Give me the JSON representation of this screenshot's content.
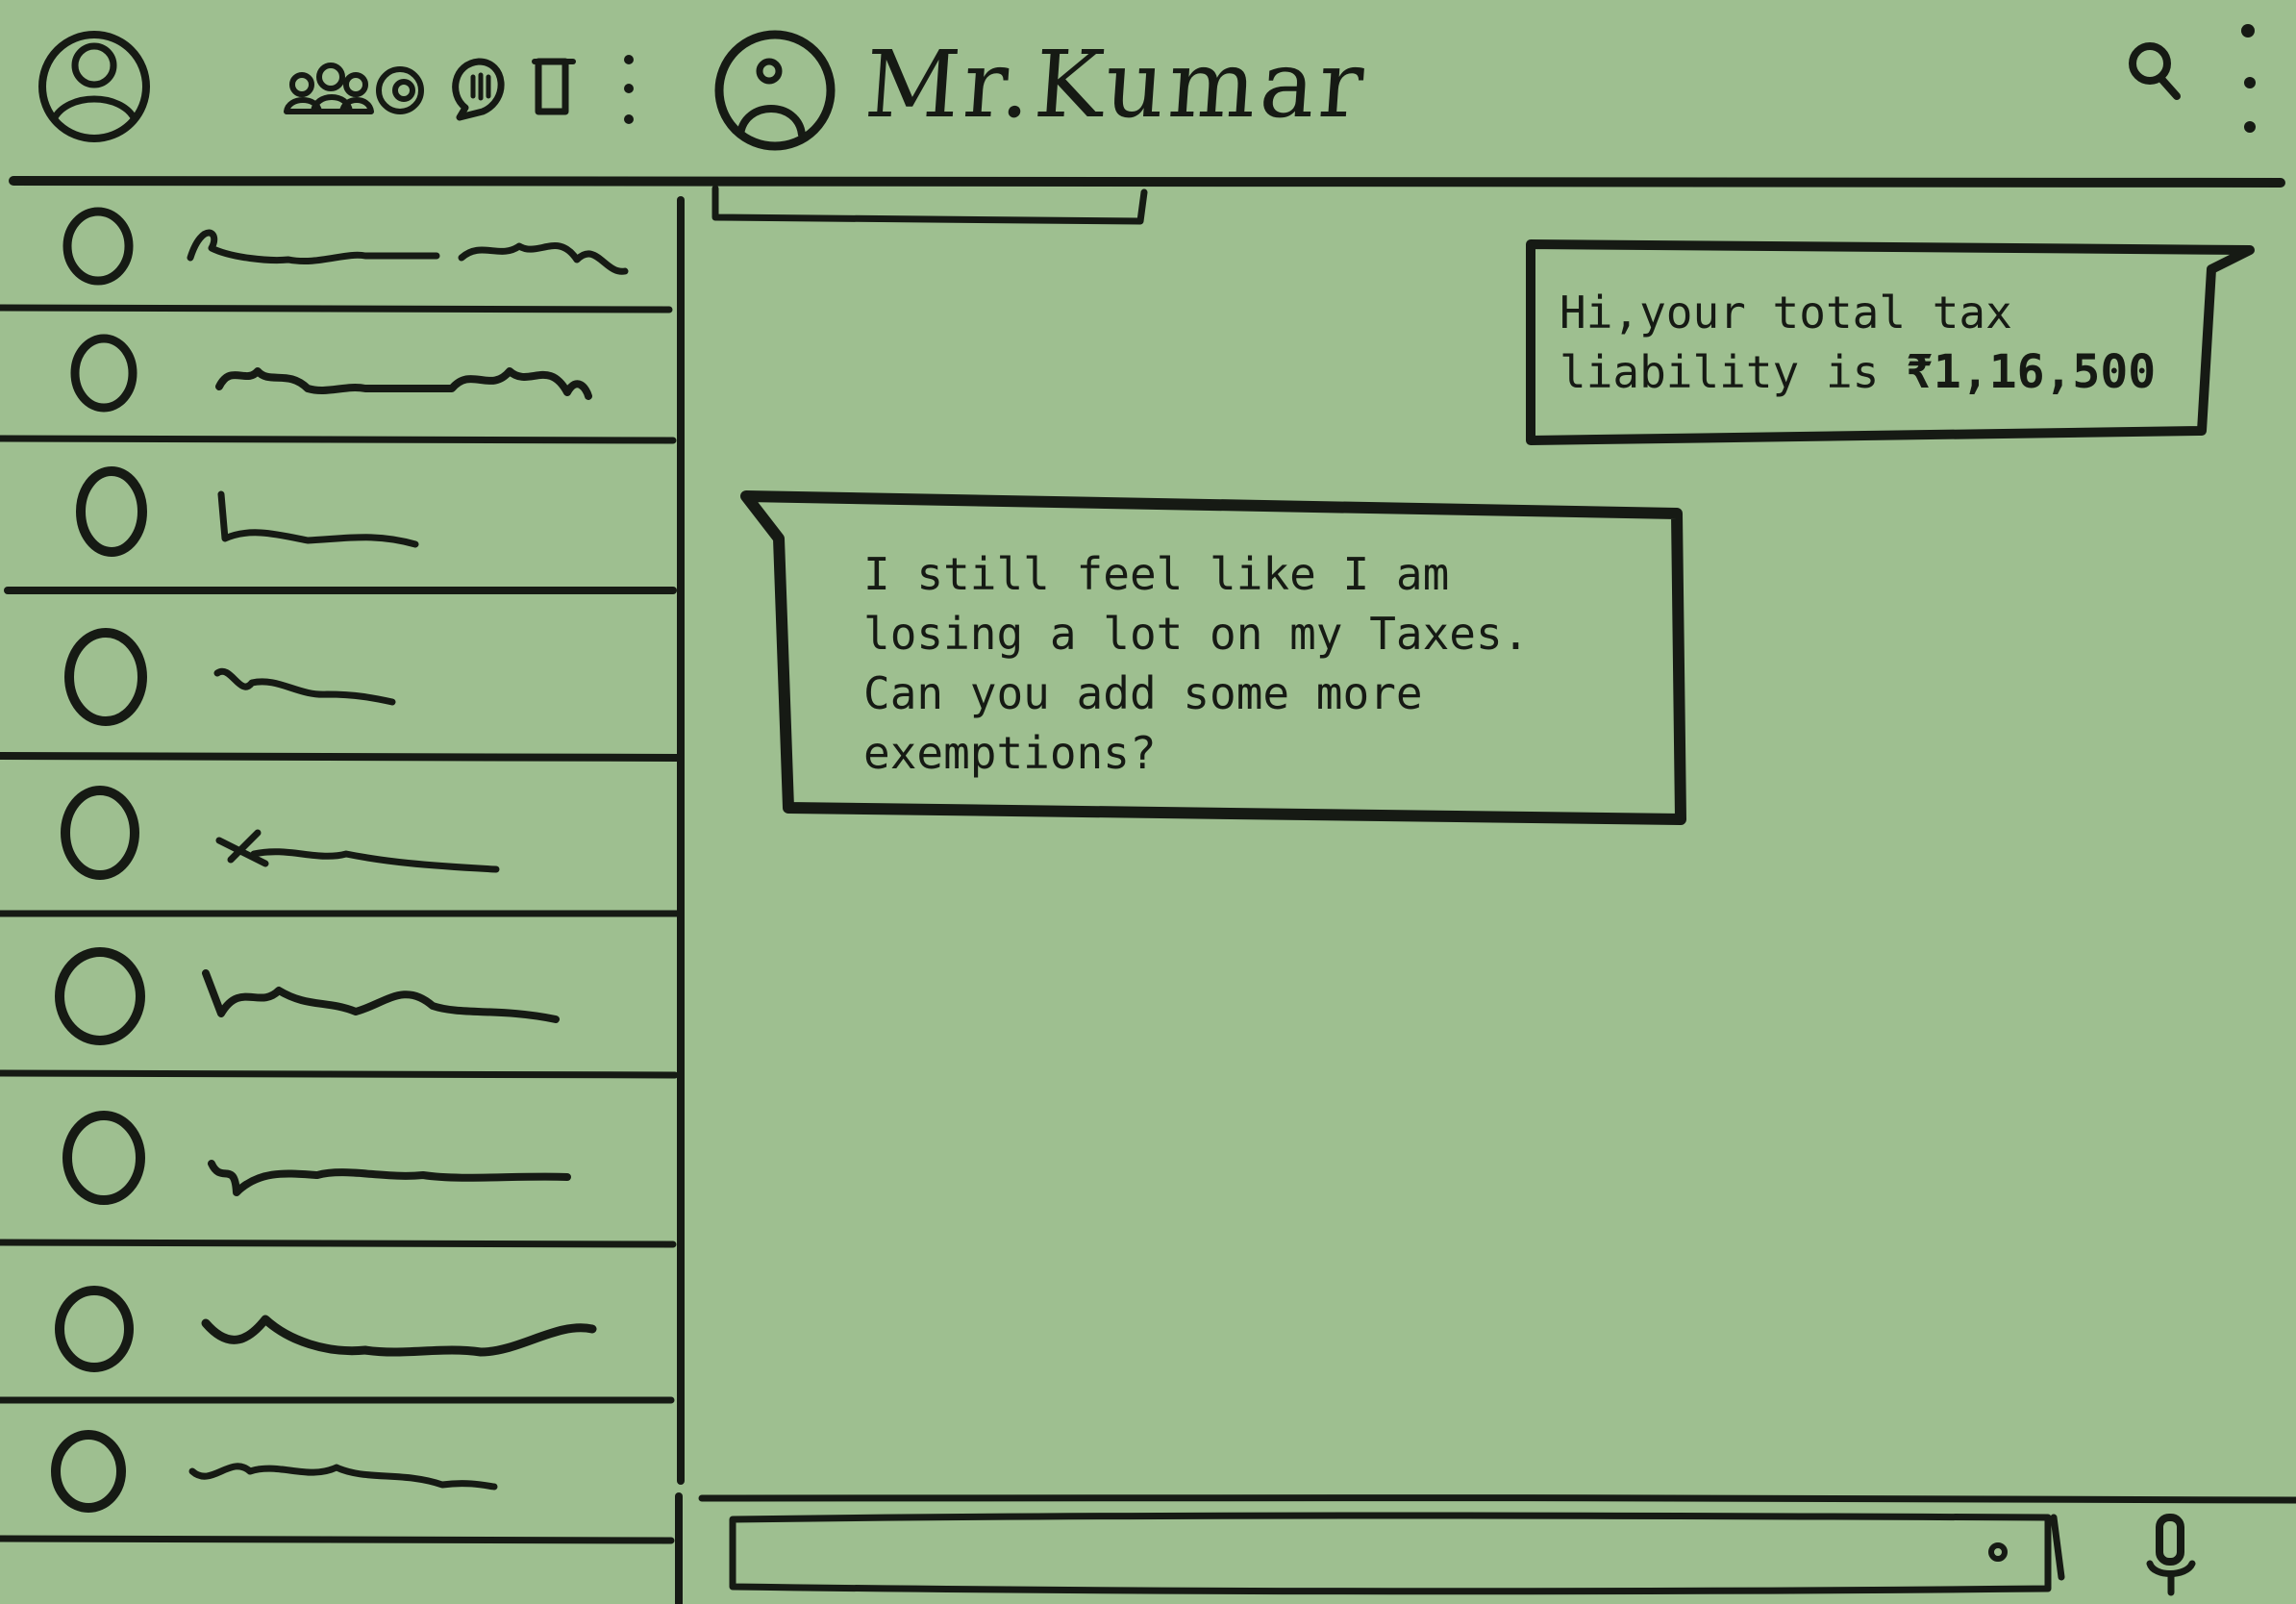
{
  "header": {
    "contact_name": "Mr.Kumar",
    "icons": [
      "profile-avatar-icon",
      "communities-icon",
      "status-icon",
      "channels-icon",
      "new-chat-icon",
      "menu-dots-icon",
      "contact-avatar-icon",
      "search-icon",
      "menu-dots-icon"
    ]
  },
  "sidebar": {
    "chat_count": 9
  },
  "conversation": {
    "messages": [
      {
        "side": "incoming-right",
        "text": "Hi,your total tax\nliability is ",
        "amount": "₹1,16,500"
      },
      {
        "side": "outgoing-left",
        "text": "I still feel like I am\nlosing a lot on my Taxes.\nCan you add some more\nexemptions?"
      }
    ]
  },
  "composer": {
    "value": "",
    "placeholder": ""
  },
  "colors": {
    "background": "#9ebf90",
    "ink": "#161a14"
  }
}
